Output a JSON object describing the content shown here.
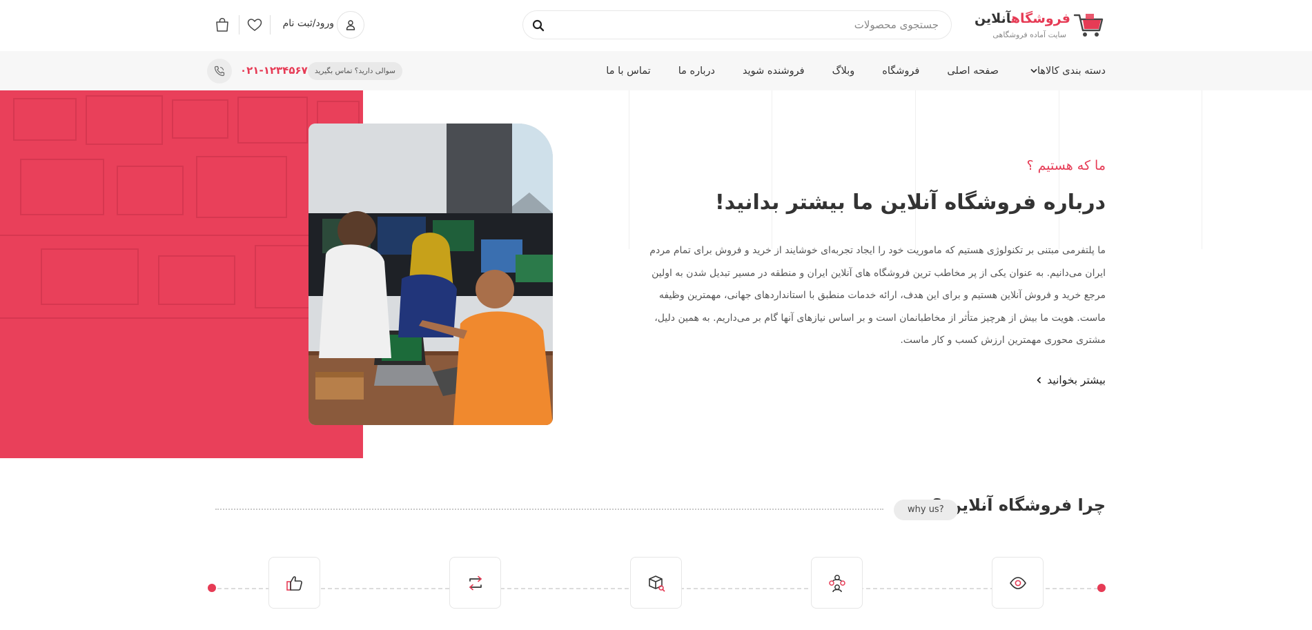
{
  "header": {
    "logo": {
      "brand_main": "فروشگاه",
      "brand_rest": "آنلاین",
      "tagline": "سایت آماده فروشگاهی"
    },
    "search": {
      "placeholder": "جستجوی محصولات"
    },
    "user": {
      "login_label": "ورود/ثبت نام"
    }
  },
  "nav": {
    "items": [
      {
        "label": "دسته بندی کالاها"
      },
      {
        "label": "صفحه اصلی"
      },
      {
        "label": "فروشگاه"
      },
      {
        "label": "وبلاگ"
      },
      {
        "label": "فروشنده شوید"
      },
      {
        "label": "درباره ما"
      },
      {
        "label": "تماس با ما"
      }
    ],
    "contact": {
      "question": "سوالی دارید؟ تماس بگیرید",
      "phone": "۰۲۱-۱۲۳۴۵۶۷"
    }
  },
  "about": {
    "subtitle": "ما که هستیم ؟",
    "title": "درباره فروشگاه آنلاین ما بیشتر بدانید!",
    "lines": [
      "ما پلتفرمی مبتنی بر تکنولوژی هستیم که ماموریت خود را ایجاد تجربه‌ای خوشایند از خرید و فروش برای تمام مردم",
      "ایران می‌دانیم. به عنوان یکی از پر مخاطب ترین فروشگاه های آنلاین ایران و منطقه در مسیر تبدیل شدن به اولین",
      "مرجع خرید و فروش آنلاین هستیم و برای این هدف، ارائه خدمات منطبق با استانداردهای جهانی، مهمترین وظیفه",
      "ماست. هویت ما بیش از هرچیز متأثر از مخاطبانمان است و بر اساس نیازهای آنها گام بر می‌داریم. به همین دلیل،",
      "مشتری محوری مهمترین ارزش کسب و کار ماست."
    ],
    "read_more": "بیشتر بخوانید"
  },
  "why": {
    "title": "چرا فروشگاه آنلاین ؟",
    "pill": "why us?",
    "features": [
      {
        "icon": "eye-icon"
      },
      {
        "icon": "users-icon"
      },
      {
        "icon": "box-search-icon"
      },
      {
        "icon": "exchange-icon"
      },
      {
        "icon": "thumbs-up-icon"
      }
    ]
  },
  "colors": {
    "accent": "#e63b55",
    "hero_block": "#e9405a",
    "navbar_bg": "#f7f7f7"
  }
}
